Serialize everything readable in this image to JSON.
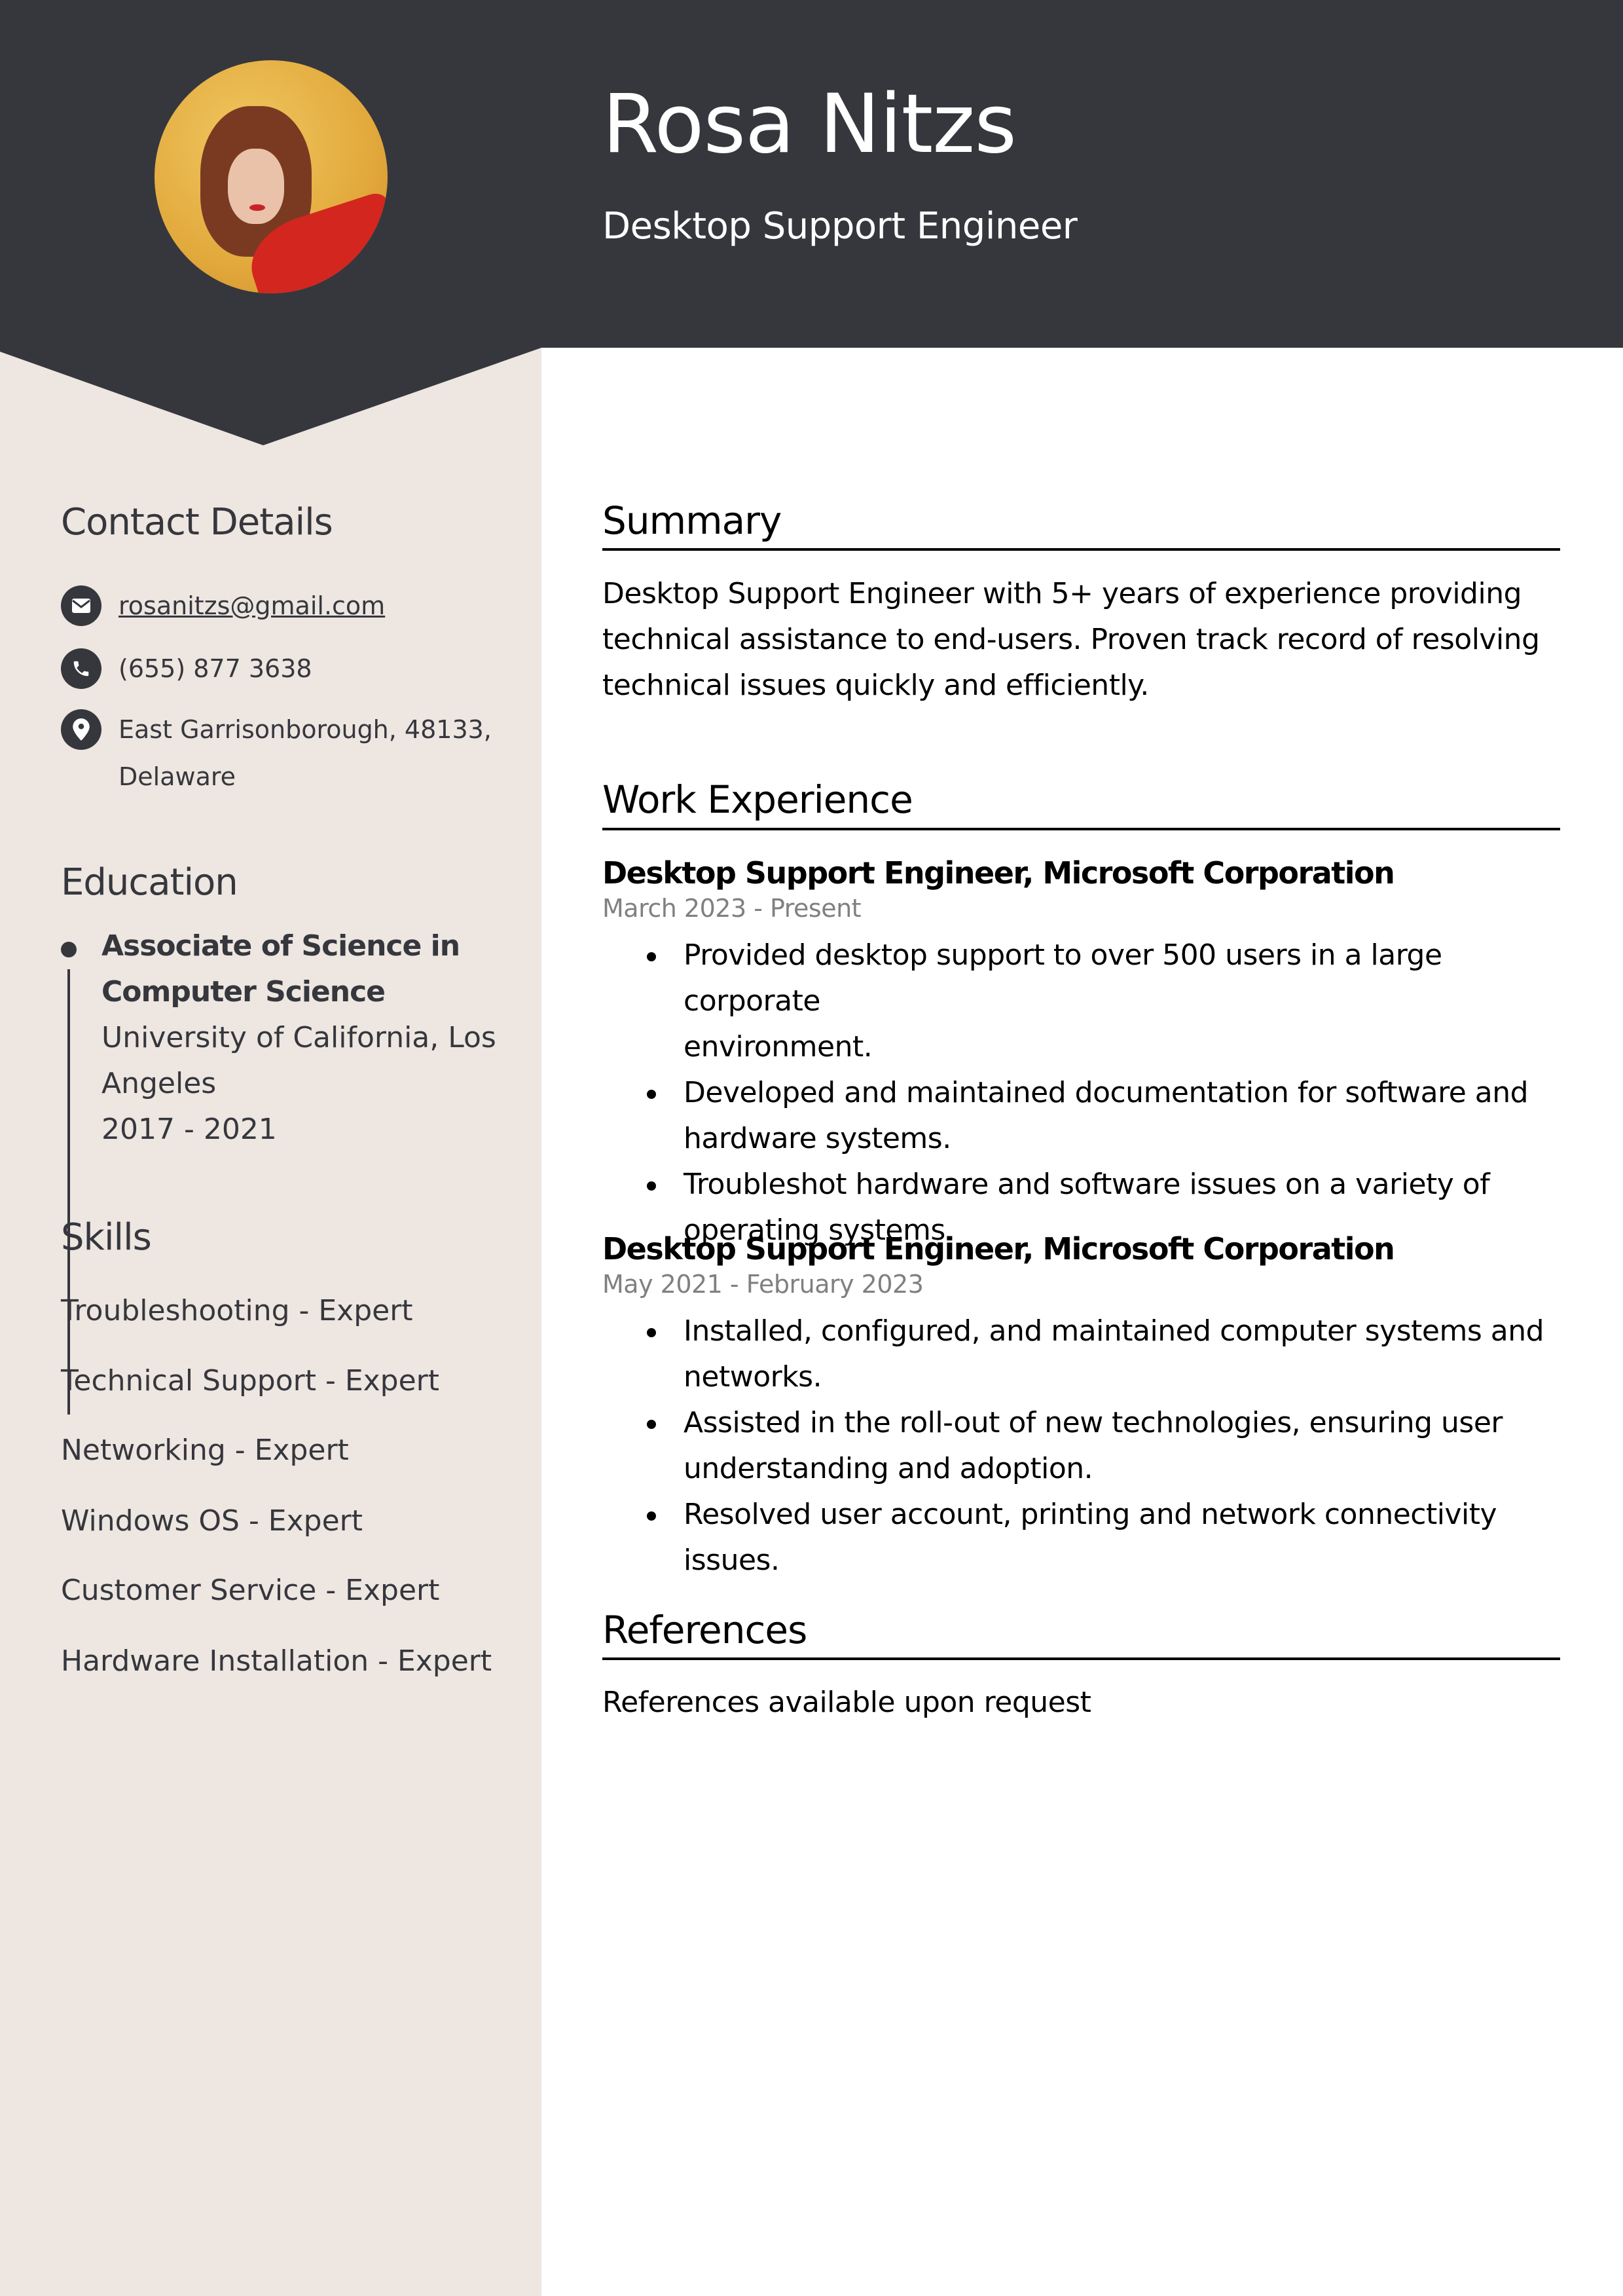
{
  "header": {
    "name": "Rosa Nitzs",
    "title": "Desktop Support Engineer",
    "photo_alt": "Portrait photo"
  },
  "colors": {
    "header_bg": "#36373d",
    "sidebar_bg": "#ede6e1",
    "text_dark": "#36373d",
    "date_gray": "#808080"
  },
  "sidebar": {
    "contact": {
      "heading": "Contact Details",
      "items": [
        {
          "icon": "envelope-icon",
          "text": "rosanitzs@gmail.com"
        },
        {
          "icon": "phone-icon",
          "text": "(655) 877 3638"
        },
        {
          "icon": "location-pin-icon",
          "text_line1": "East Garrisonborough, 48133,",
          "text_line2": "Delaware"
        }
      ]
    },
    "education": {
      "heading": "Education",
      "entries": [
        {
          "degree_line1": "Associate of Science in",
          "degree_line2": "Computer Science",
          "school_line1": "University of California, Los",
          "school_line2": "Angeles",
          "years": "2017 - 2021"
        }
      ]
    },
    "skills": {
      "heading": "Skills",
      "items": [
        "Troubleshooting - Expert",
        "Technical Support - Expert",
        "Networking - Expert",
        "Windows OS - Expert",
        "Customer Service - Expert",
        "Hardware Installation - Expert"
      ]
    }
  },
  "main": {
    "summary": {
      "heading": "Summary",
      "lines": [
        "Desktop Support Engineer with 5+ years of experience providing",
        "technical assistance to end-users. Proven track record of resolving",
        "technical issues quickly and efficiently."
      ]
    },
    "experience": {
      "heading": "Work Experience",
      "jobs": [
        {
          "title": "Desktop Support Engineer, Microsoft Corporation",
          "dates": "March 2023 - Present",
          "bullets": [
            {
              "l1": "Provided desktop support to over 500 users in a large corporate",
              "l2": "environment."
            },
            {
              "l1": "Developed and maintained documentation for software and",
              "l2": "hardware systems."
            },
            {
              "l1": "Troubleshot hardware and software issues on a variety of",
              "l2": "operating systems."
            }
          ]
        },
        {
          "title": "Desktop Support Engineer, Microsoft Corporation",
          "dates": "May 2021 - February 2023",
          "bullets": [
            {
              "l1": "Installed, configured, and maintained computer systems and",
              "l2": "networks."
            },
            {
              "l1": "Assisted in the roll-out of new technologies, ensuring user",
              "l2": "understanding and adoption."
            },
            {
              "l1": "Resolved user account, printing and network connectivity issues.",
              "l2": ""
            }
          ]
        }
      ]
    },
    "references": {
      "heading": "References",
      "text": "References available upon request"
    }
  }
}
